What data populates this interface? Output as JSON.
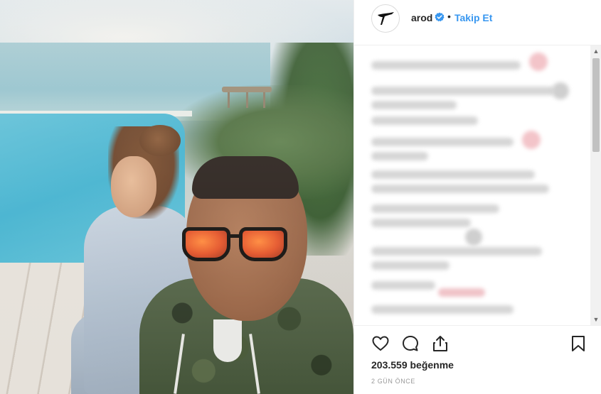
{
  "post": {
    "username": "arod",
    "separator": "•",
    "follow_label": "Takip Et",
    "likes_text": "203.559 beğenme",
    "time_text": "2 GÜN ÖNCE"
  },
  "icons": {
    "avatar": "arod-logo-icon",
    "verified": "verified-badge-icon",
    "like": "heart-icon",
    "comment": "comment-icon",
    "share": "share-icon",
    "save": "bookmark-icon",
    "scroll_up": "chevron-up-icon",
    "scroll_down": "chevron-down-icon"
  },
  "colors": {
    "follow": "#3897f0",
    "verified": "#3897f0",
    "text": "#262626",
    "muted": "#999999"
  }
}
